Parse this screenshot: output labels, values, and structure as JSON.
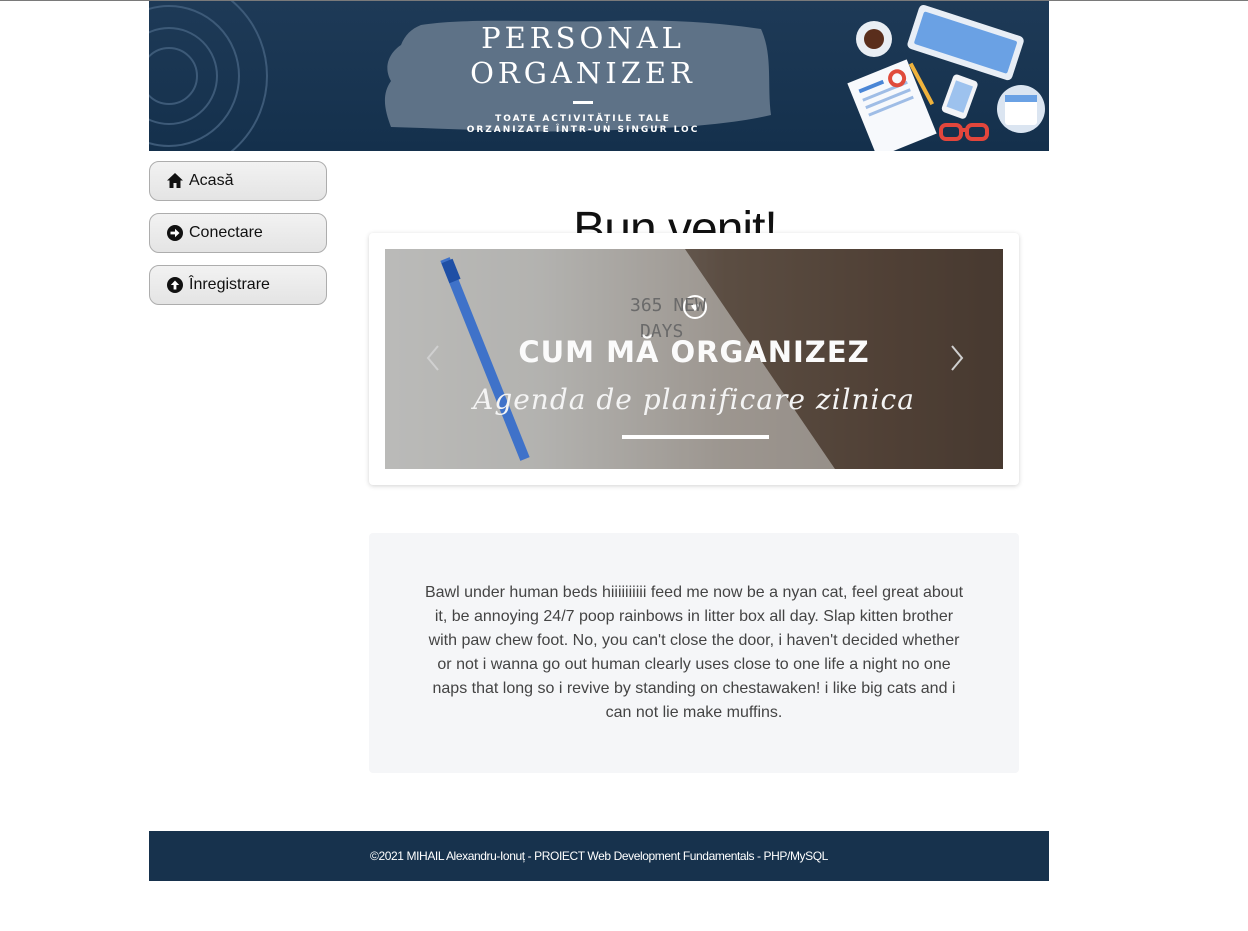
{
  "header": {
    "title_line1": "PERSONAL",
    "title_line2": "ORGANIZER",
    "subtitle_line1": "TOATE ACTIVITĂȚILE TALE",
    "subtitle_line2": "ORZANIZATE ÎNTR-UN SINGUR LOC"
  },
  "sidebar": {
    "items": [
      {
        "label": "Acasă",
        "icon": "home-icon"
      },
      {
        "label": "Conectare",
        "icon": "arrow-right-circle-icon"
      },
      {
        "label": "Înregistrare",
        "icon": "arrow-up-circle-icon"
      }
    ]
  },
  "main": {
    "heading": "Bun venit!",
    "carousel": {
      "slide_title": "CUM MĂ ORGANIZEZ",
      "slide_subtitle": "Agenda de planificare zilnica",
      "slide_image_text": "365 NEW DAYS"
    },
    "paragraph": "Bawl under human beds hiiiiiiiiii feed me now be a nyan cat, feel great about it, be annoying 24/7 poop rainbows in litter box all day. Slap kitten brother with paw chew foot. No, you can't close the door, i haven't decided whether or not i wanna go out human clearly uses close to one life a night no one naps that long so i revive by standing on chestawaken! i like big cats and i can not lie make muffins."
  },
  "footer": {
    "text": "©2021 MIHAIL Alexandru-Ionuț - PROIECT Web Development Fundamentals - PHP/MySQL"
  },
  "colors": {
    "banner_bg": "#1a3654",
    "footer_bg": "#17324d",
    "text_box_bg": "#f5f6f8"
  }
}
